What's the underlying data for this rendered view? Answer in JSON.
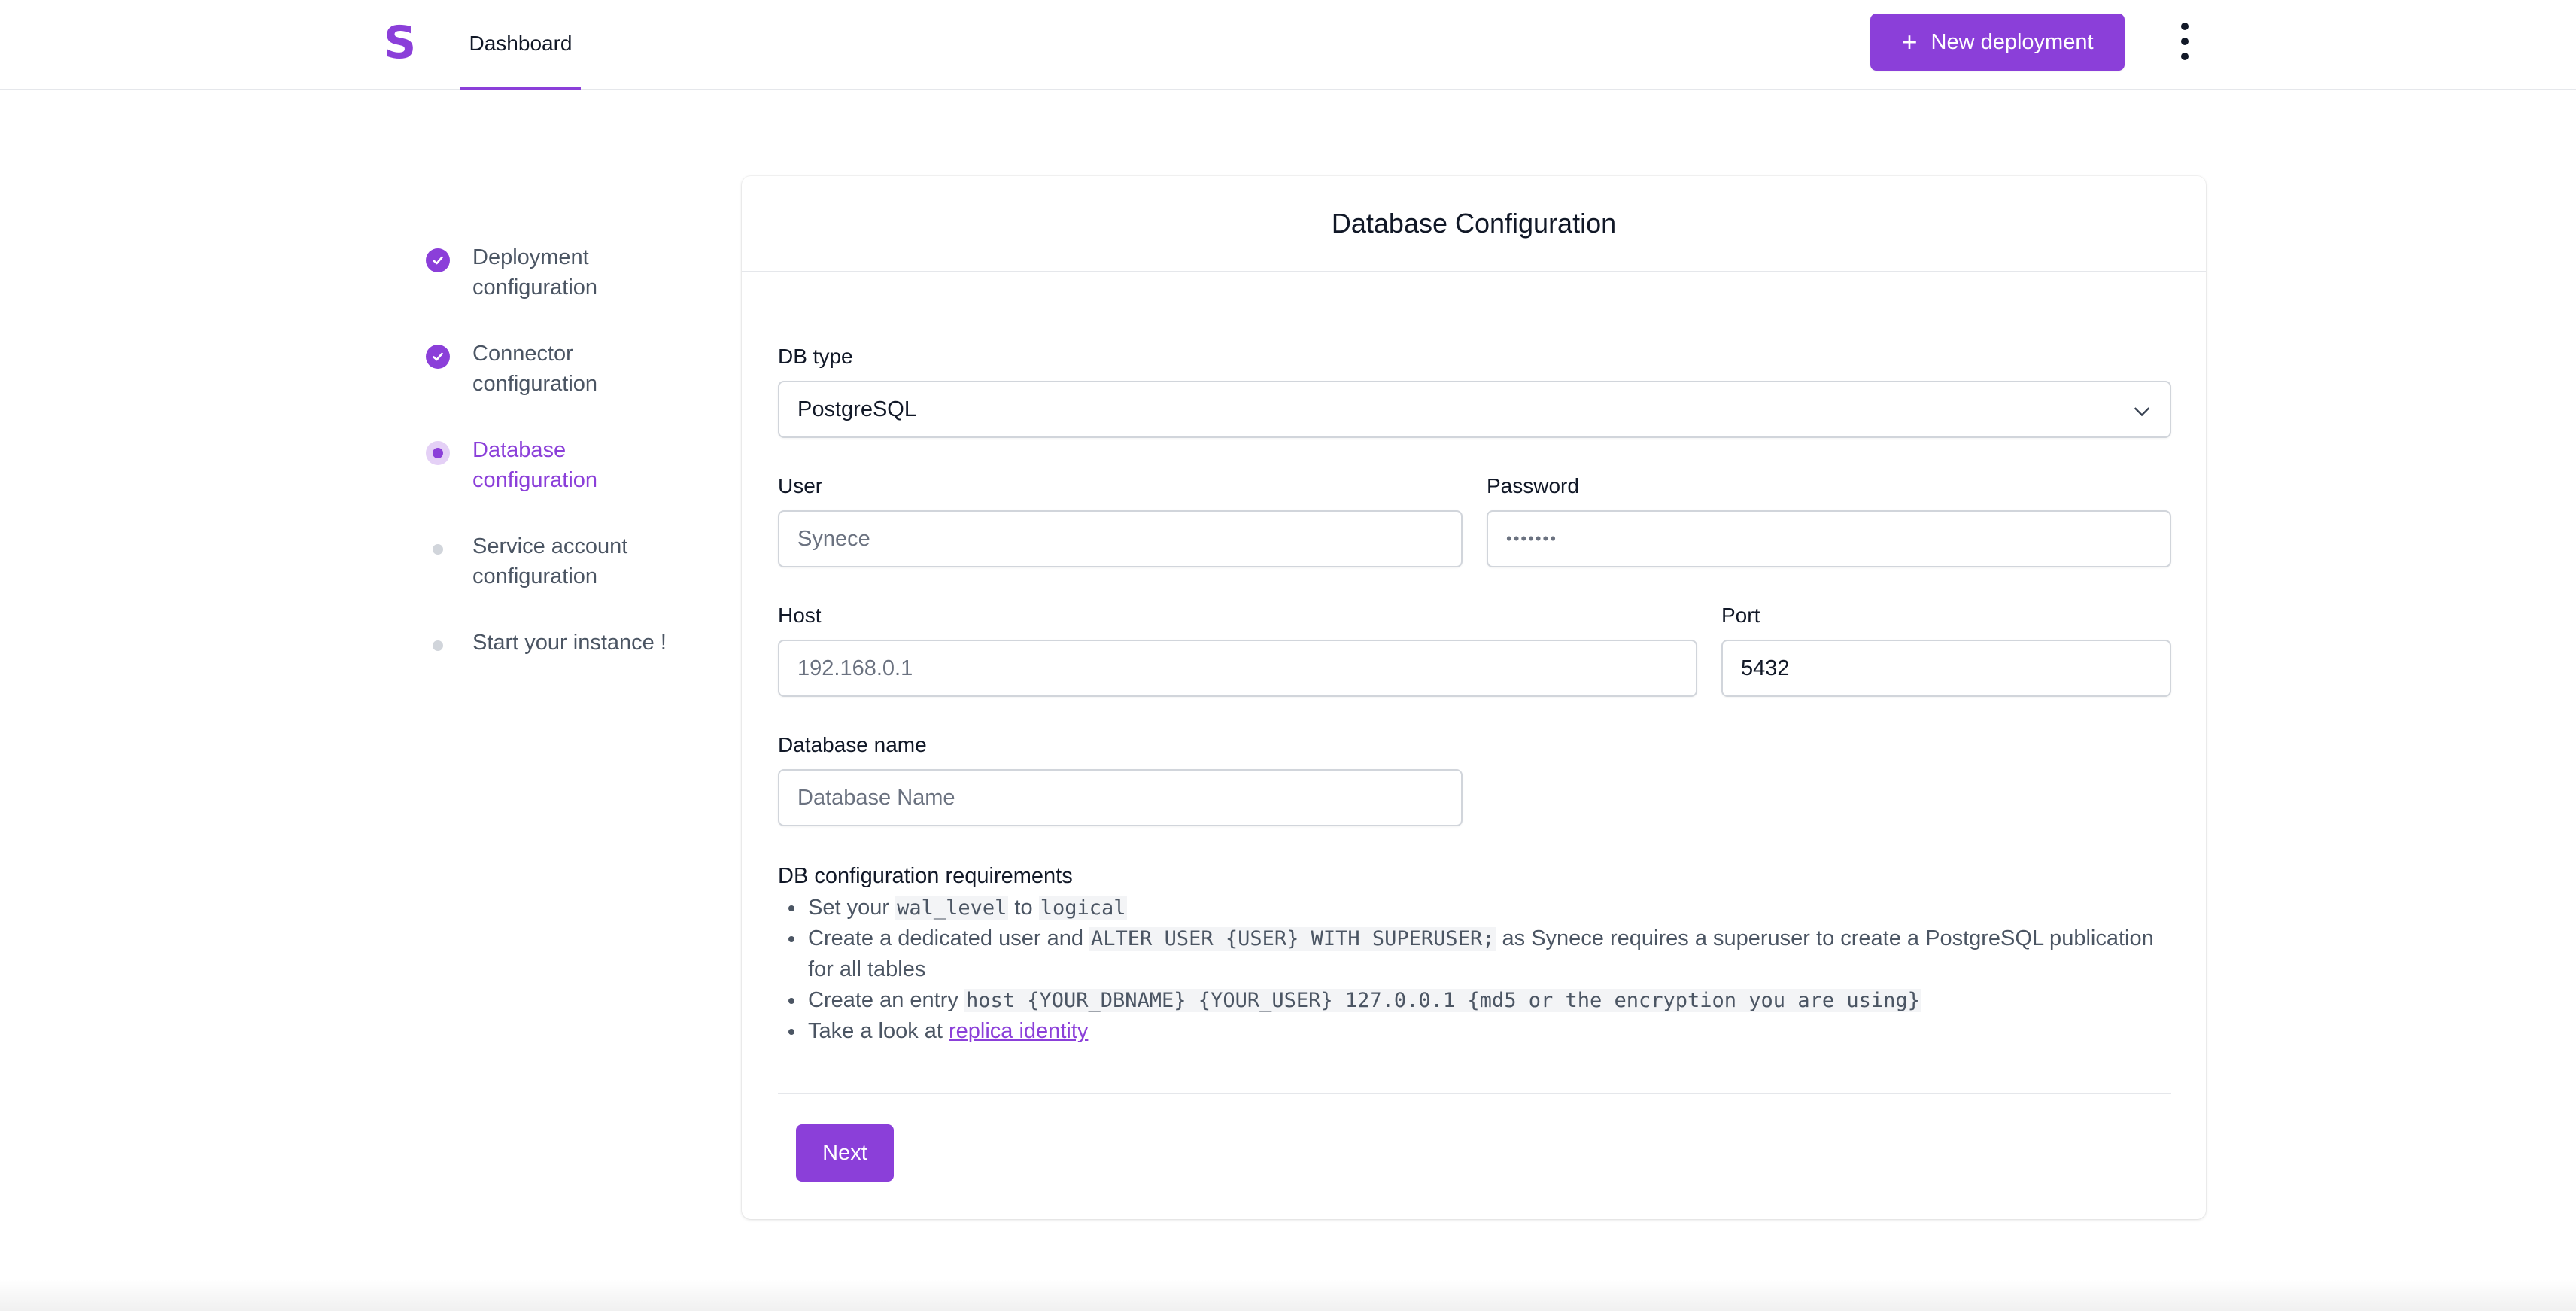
{
  "topnav": {
    "logo": "S",
    "tab_dashboard": "Dashboard",
    "new_deployment_label": "New deployment",
    "plus_icon": "+"
  },
  "stepper": {
    "steps": [
      {
        "label": "Deployment\nconfiguration",
        "state": "done"
      },
      {
        "label": "Connector\nconfiguration",
        "state": "done"
      },
      {
        "label": "Database\nconfiguration",
        "state": "current"
      },
      {
        "label": "Service account\nconfiguration",
        "state": "upcoming"
      },
      {
        "label": "Start your instance !",
        "state": "upcoming"
      }
    ]
  },
  "form": {
    "title": "Database Configuration",
    "db_type": {
      "label": "DB type",
      "value": "PostgreSQL"
    },
    "user": {
      "label": "User",
      "placeholder": "Synece"
    },
    "password": {
      "label": "Password",
      "placeholder": "•••••••"
    },
    "host": {
      "label": "Host",
      "placeholder": "192.168.0.1"
    },
    "port": {
      "label": "Port",
      "value": "5432"
    },
    "database_name": {
      "label": "Database name",
      "placeholder": "Database Name"
    }
  },
  "requirements": {
    "title": "DB configuration requirements",
    "item1": {
      "pre": "Set your ",
      "code1": "wal_level",
      "mid": " to ",
      "code2": "logical"
    },
    "item2": {
      "pre": "Create a dedicated user and ",
      "code": "ALTER USER {USER} WITH SUPERUSER;",
      "post": " as Synece requires a superuser to create a PostgreSQL publication for all tables"
    },
    "item3": {
      "pre": "Create an entry ",
      "code": "host {YOUR_DBNAME} {YOUR_USER} 127.0.0.1 {md5 or the encryption you are using}"
    },
    "item4": {
      "pre": "Take a look at ",
      "link": "replica identity"
    }
  },
  "actions": {
    "next_label": "Next"
  },
  "colors": {
    "accent": "#8b3fd9",
    "text": "#111827",
    "muted": "#4b5563",
    "border": "#d1d5db"
  }
}
